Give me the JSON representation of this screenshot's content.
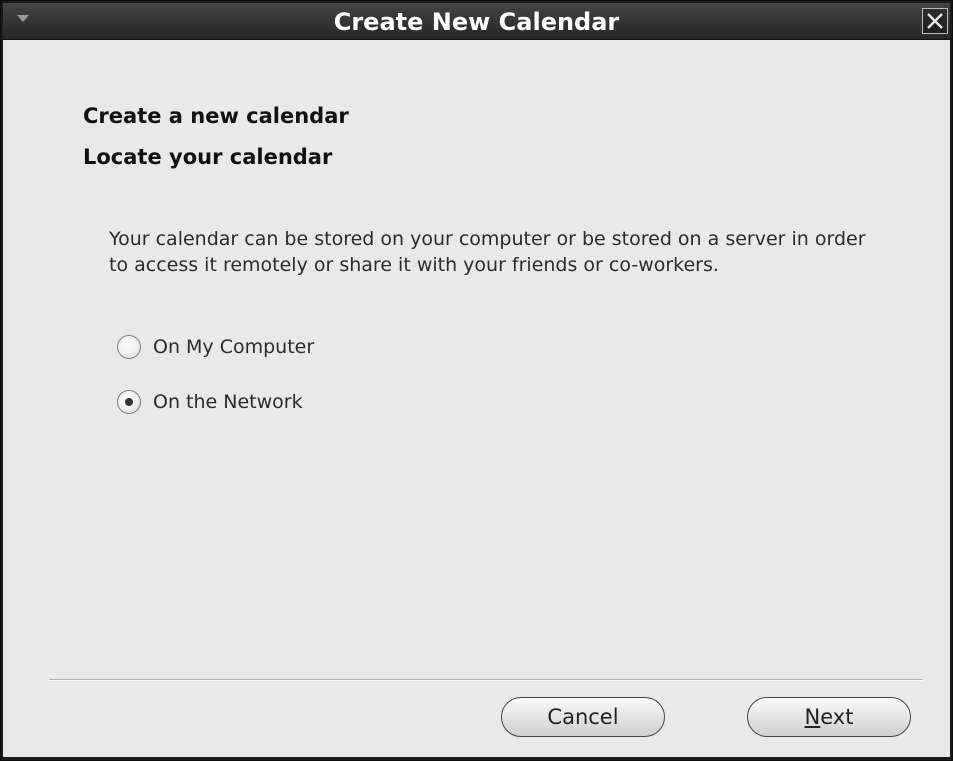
{
  "window": {
    "title": "Create New Calendar"
  },
  "page": {
    "heading": "Create a new calendar",
    "subheading": "Locate your calendar",
    "description": "Your calendar can be stored on your computer or be stored on a server in order to access it remotely or share it with your friends or co-workers."
  },
  "location_options": [
    {
      "label": "On My Computer",
      "selected": false
    },
    {
      "label": "On the Network",
      "selected": true
    }
  ],
  "buttons": {
    "cancel": "Cancel",
    "next_mnemonic": "N",
    "next_rest": "ext"
  },
  "icons": {
    "window_menu": "chevron-down-icon",
    "close": "close-icon"
  }
}
